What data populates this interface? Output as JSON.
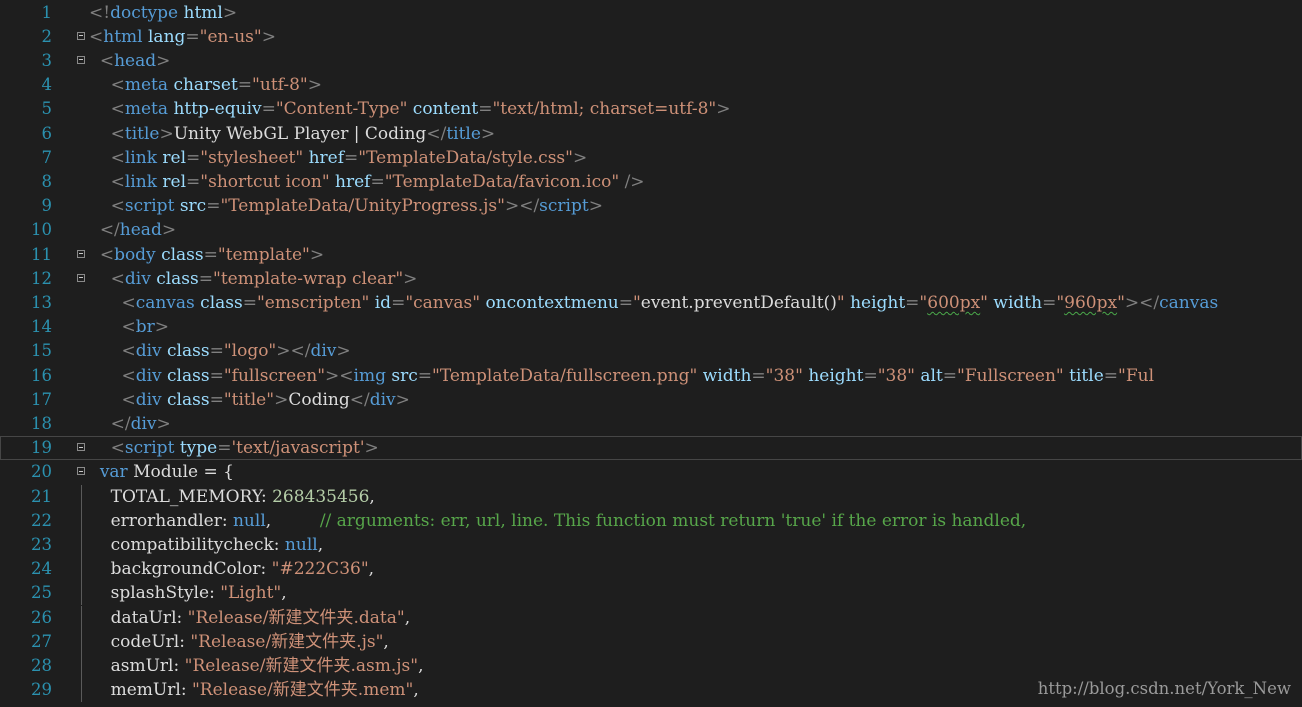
{
  "editor": {
    "current_line": 19,
    "watermark": "http://blog.csdn.net/York_New",
    "lines": [
      {
        "n": "1",
        "fold": false,
        "guide": false,
        "tokens": [
          [
            "punct",
            "<!"
          ],
          [
            "tag",
            "doctype"
          ],
          [
            "text",
            " "
          ],
          [
            "attr",
            "html"
          ],
          [
            "punct",
            ">"
          ]
        ]
      },
      {
        "n": "2",
        "fold": true,
        "guide": false,
        "tokens": [
          [
            "punct",
            "<"
          ],
          [
            "tag",
            "html"
          ],
          [
            "text",
            " "
          ],
          [
            "attr",
            "lang"
          ],
          [
            "punct",
            "="
          ],
          [
            "str",
            "\"en-us\""
          ],
          [
            "punct",
            ">"
          ]
        ]
      },
      {
        "n": "3",
        "fold": true,
        "guide": false,
        "tokens": [
          [
            "text",
            "  "
          ],
          [
            "punct",
            "<"
          ],
          [
            "tag",
            "head"
          ],
          [
            "punct",
            ">"
          ]
        ]
      },
      {
        "n": "4",
        "fold": false,
        "guide": false,
        "tokens": [
          [
            "text",
            "    "
          ],
          [
            "punct",
            "<"
          ],
          [
            "tag",
            "meta"
          ],
          [
            "text",
            " "
          ],
          [
            "attr",
            "charset"
          ],
          [
            "punct",
            "="
          ],
          [
            "str",
            "\"utf-8\""
          ],
          [
            "punct",
            ">"
          ]
        ]
      },
      {
        "n": "5",
        "fold": false,
        "guide": false,
        "tokens": [
          [
            "text",
            "    "
          ],
          [
            "punct",
            "<"
          ],
          [
            "tag",
            "meta"
          ],
          [
            "text",
            " "
          ],
          [
            "attr",
            "http-equiv"
          ],
          [
            "punct",
            "="
          ],
          [
            "str",
            "\"Content-Type\""
          ],
          [
            "text",
            " "
          ],
          [
            "attr",
            "content"
          ],
          [
            "punct",
            "="
          ],
          [
            "str",
            "\"text/html; charset=utf-8\""
          ],
          [
            "punct",
            ">"
          ]
        ]
      },
      {
        "n": "6",
        "fold": false,
        "guide": false,
        "tokens": [
          [
            "text",
            "    "
          ],
          [
            "punct",
            "<"
          ],
          [
            "tag",
            "title"
          ],
          [
            "punct",
            ">"
          ],
          [
            "text",
            "Unity WebGL Player | Coding"
          ],
          [
            "punct",
            "</"
          ],
          [
            "tag",
            "title"
          ],
          [
            "punct",
            ">"
          ]
        ]
      },
      {
        "n": "7",
        "fold": false,
        "guide": false,
        "tokens": [
          [
            "text",
            "    "
          ],
          [
            "punct",
            "<"
          ],
          [
            "tag",
            "link"
          ],
          [
            "text",
            " "
          ],
          [
            "attr",
            "rel"
          ],
          [
            "punct",
            "="
          ],
          [
            "str",
            "\"stylesheet\""
          ],
          [
            "text",
            " "
          ],
          [
            "attr",
            "href"
          ],
          [
            "punct",
            "="
          ],
          [
            "str",
            "\"TemplateData/style.css\""
          ],
          [
            "punct",
            ">"
          ]
        ]
      },
      {
        "n": "8",
        "fold": false,
        "guide": false,
        "tokens": [
          [
            "text",
            "    "
          ],
          [
            "punct",
            "<"
          ],
          [
            "tag",
            "link"
          ],
          [
            "text",
            " "
          ],
          [
            "attr",
            "rel"
          ],
          [
            "punct",
            "="
          ],
          [
            "str",
            "\"shortcut icon\""
          ],
          [
            "text",
            " "
          ],
          [
            "attr",
            "href"
          ],
          [
            "punct",
            "="
          ],
          [
            "str",
            "\"TemplateData/favicon.ico\""
          ],
          [
            "text",
            " "
          ],
          [
            "punct",
            "/>"
          ]
        ]
      },
      {
        "n": "9",
        "fold": false,
        "guide": false,
        "tokens": [
          [
            "text",
            "    "
          ],
          [
            "punct",
            "<"
          ],
          [
            "tag",
            "script"
          ],
          [
            "text",
            " "
          ],
          [
            "attr",
            "src"
          ],
          [
            "punct",
            "="
          ],
          [
            "str",
            "\"TemplateData/UnityProgress.js\""
          ],
          [
            "punct",
            "></"
          ],
          [
            "tag",
            "script"
          ],
          [
            "punct",
            ">"
          ]
        ]
      },
      {
        "n": "10",
        "fold": false,
        "guide": false,
        "tokens": [
          [
            "text",
            "  "
          ],
          [
            "punct",
            "</"
          ],
          [
            "tag",
            "head"
          ],
          [
            "punct",
            ">"
          ]
        ]
      },
      {
        "n": "11",
        "fold": true,
        "guide": false,
        "tokens": [
          [
            "text",
            "  "
          ],
          [
            "punct",
            "<"
          ],
          [
            "tag",
            "body"
          ],
          [
            "text",
            " "
          ],
          [
            "attr",
            "class"
          ],
          [
            "punct",
            "="
          ],
          [
            "str",
            "\"template\""
          ],
          [
            "punct",
            ">"
          ]
        ]
      },
      {
        "n": "12",
        "fold": true,
        "guide": false,
        "tokens": [
          [
            "text",
            "    "
          ],
          [
            "punct",
            "<"
          ],
          [
            "tag",
            "div"
          ],
          [
            "text",
            " "
          ],
          [
            "attr",
            "class"
          ],
          [
            "punct",
            "="
          ],
          [
            "str",
            "\"template-wrap clear\""
          ],
          [
            "punct",
            ">"
          ]
        ]
      },
      {
        "n": "13",
        "fold": false,
        "guide": false,
        "tokens": [
          [
            "text",
            "      "
          ],
          [
            "punct",
            "<"
          ],
          [
            "tag",
            "canvas"
          ],
          [
            "text",
            " "
          ],
          [
            "attr",
            "class"
          ],
          [
            "punct",
            "="
          ],
          [
            "str",
            "\"emscripten\""
          ],
          [
            "text",
            " "
          ],
          [
            "attr",
            "id"
          ],
          [
            "punct",
            "="
          ],
          [
            "str",
            "\"canvas\""
          ],
          [
            "text",
            " "
          ],
          [
            "attr",
            "oncontextmenu"
          ],
          [
            "punct",
            "="
          ],
          [
            "str",
            "\""
          ],
          [
            "text",
            "event.preventDefault()"
          ],
          [
            "str",
            "\""
          ],
          [
            "text",
            " "
          ],
          [
            "attr",
            "height"
          ],
          [
            "punct",
            "="
          ],
          [
            "str",
            "\""
          ],
          [
            "squig",
            "600px"
          ],
          [
            "str",
            "\""
          ],
          [
            "text",
            " "
          ],
          [
            "attr",
            "width"
          ],
          [
            "punct",
            "="
          ],
          [
            "str",
            "\""
          ],
          [
            "squig",
            "960px"
          ],
          [
            "str",
            "\""
          ],
          [
            "punct",
            "></"
          ],
          [
            "tag",
            "canvas"
          ]
        ]
      },
      {
        "n": "14",
        "fold": false,
        "guide": false,
        "tokens": [
          [
            "text",
            "      "
          ],
          [
            "punct",
            "<"
          ],
          [
            "tag",
            "br"
          ],
          [
            "punct",
            ">"
          ]
        ]
      },
      {
        "n": "15",
        "fold": false,
        "guide": false,
        "tokens": [
          [
            "text",
            "      "
          ],
          [
            "punct",
            "<"
          ],
          [
            "tag",
            "div"
          ],
          [
            "text",
            " "
          ],
          [
            "attr",
            "class"
          ],
          [
            "punct",
            "="
          ],
          [
            "str",
            "\"logo\""
          ],
          [
            "punct",
            "></"
          ],
          [
            "tag",
            "div"
          ],
          [
            "punct",
            ">"
          ]
        ]
      },
      {
        "n": "16",
        "fold": false,
        "guide": false,
        "tokens": [
          [
            "text",
            "      "
          ],
          [
            "punct",
            "<"
          ],
          [
            "tag",
            "div"
          ],
          [
            "text",
            " "
          ],
          [
            "attr",
            "class"
          ],
          [
            "punct",
            "="
          ],
          [
            "str",
            "\"fullscreen\""
          ],
          [
            "punct",
            "><"
          ],
          [
            "tag",
            "img"
          ],
          [
            "text",
            " "
          ],
          [
            "attr",
            "src"
          ],
          [
            "punct",
            "="
          ],
          [
            "str",
            "\"TemplateData/fullscreen.png\""
          ],
          [
            "text",
            " "
          ],
          [
            "attr",
            "width"
          ],
          [
            "punct",
            "="
          ],
          [
            "str",
            "\"38\""
          ],
          [
            "text",
            " "
          ],
          [
            "attr",
            "height"
          ],
          [
            "punct",
            "="
          ],
          [
            "str",
            "\"38\""
          ],
          [
            "text",
            " "
          ],
          [
            "attr",
            "alt"
          ],
          [
            "punct",
            "="
          ],
          [
            "str",
            "\"Fullscreen\""
          ],
          [
            "text",
            " "
          ],
          [
            "attr",
            "title"
          ],
          [
            "punct",
            "="
          ],
          [
            "str",
            "\"Ful"
          ]
        ]
      },
      {
        "n": "17",
        "fold": false,
        "guide": false,
        "tokens": [
          [
            "text",
            "      "
          ],
          [
            "punct",
            "<"
          ],
          [
            "tag",
            "div"
          ],
          [
            "text",
            " "
          ],
          [
            "attr",
            "class"
          ],
          [
            "punct",
            "="
          ],
          [
            "str",
            "\"title\""
          ],
          [
            "punct",
            ">"
          ],
          [
            "text",
            "Coding"
          ],
          [
            "punct",
            "</"
          ],
          [
            "tag",
            "div"
          ],
          [
            "punct",
            ">"
          ]
        ]
      },
      {
        "n": "18",
        "fold": false,
        "guide": false,
        "tokens": [
          [
            "text",
            "    "
          ],
          [
            "punct",
            "</"
          ],
          [
            "tag",
            "div"
          ],
          [
            "punct",
            ">"
          ]
        ]
      },
      {
        "n": "19",
        "fold": true,
        "guide": false,
        "tokens": [
          [
            "text",
            "    "
          ],
          [
            "punct",
            "<"
          ],
          [
            "tag",
            "script"
          ],
          [
            "text",
            " "
          ],
          [
            "attr",
            "type"
          ],
          [
            "punct",
            "="
          ],
          [
            "str",
            "'text/javascript'"
          ],
          [
            "punct",
            ">"
          ]
        ]
      },
      {
        "n": "20",
        "fold": true,
        "guide": false,
        "tokens": [
          [
            "text",
            "  "
          ],
          [
            "kw",
            "var"
          ],
          [
            "text",
            " Module = {"
          ]
        ]
      },
      {
        "n": "21",
        "fold": false,
        "guide": true,
        "tokens": [
          [
            "text",
            "    "
          ],
          [
            "prop",
            "TOTAL_MEMORY"
          ],
          [
            "text",
            ": "
          ],
          [
            "num",
            "268435456"
          ],
          [
            "text",
            ","
          ]
        ]
      },
      {
        "n": "22",
        "fold": false,
        "guide": true,
        "tokens": [
          [
            "text",
            "    "
          ],
          [
            "prop",
            "errorhandler"
          ],
          [
            "text",
            ": "
          ],
          [
            "kw",
            "null"
          ],
          [
            "text",
            ",         "
          ],
          [
            "comment",
            "// arguments: err, url, line. This function must return 'true' if the error is handled,"
          ]
        ]
      },
      {
        "n": "23",
        "fold": false,
        "guide": true,
        "tokens": [
          [
            "text",
            "    "
          ],
          [
            "prop",
            "compatibilitycheck"
          ],
          [
            "text",
            ": "
          ],
          [
            "kw",
            "null"
          ],
          [
            "text",
            ","
          ]
        ]
      },
      {
        "n": "24",
        "fold": false,
        "guide": true,
        "tokens": [
          [
            "text",
            "    "
          ],
          [
            "prop",
            "backgroundColor"
          ],
          [
            "text",
            ": "
          ],
          [
            "str",
            "\"#222C36\""
          ],
          [
            "text",
            ","
          ]
        ]
      },
      {
        "n": "25",
        "fold": false,
        "guide": true,
        "tokens": [
          [
            "text",
            "    "
          ],
          [
            "prop",
            "splashStyle"
          ],
          [
            "text",
            ": "
          ],
          [
            "str",
            "\"Light\""
          ],
          [
            "text",
            ","
          ]
        ]
      },
      {
        "n": "26",
        "fold": false,
        "guide": true,
        "tokens": [
          [
            "text",
            "    "
          ],
          [
            "prop",
            "dataUrl"
          ],
          [
            "text",
            ": "
          ],
          [
            "str",
            "\"Release/新建文件夹.data\""
          ],
          [
            "text",
            ","
          ]
        ]
      },
      {
        "n": "27",
        "fold": false,
        "guide": true,
        "tokens": [
          [
            "text",
            "    "
          ],
          [
            "prop",
            "codeUrl"
          ],
          [
            "text",
            ": "
          ],
          [
            "str",
            "\"Release/新建文件夹.js\""
          ],
          [
            "text",
            ","
          ]
        ]
      },
      {
        "n": "28",
        "fold": false,
        "guide": true,
        "tokens": [
          [
            "text",
            "    "
          ],
          [
            "prop",
            "asmUrl"
          ],
          [
            "text",
            ": "
          ],
          [
            "str",
            "\"Release/新建文件夹.asm.js\""
          ],
          [
            "text",
            ","
          ]
        ]
      },
      {
        "n": "29",
        "fold": false,
        "guide": true,
        "tokens": [
          [
            "text",
            "    "
          ],
          [
            "prop",
            "memUrl"
          ],
          [
            "text",
            ": "
          ],
          [
            "str",
            "\"Release/新建文件夹.mem\""
          ],
          [
            "text",
            ","
          ]
        ]
      }
    ]
  }
}
